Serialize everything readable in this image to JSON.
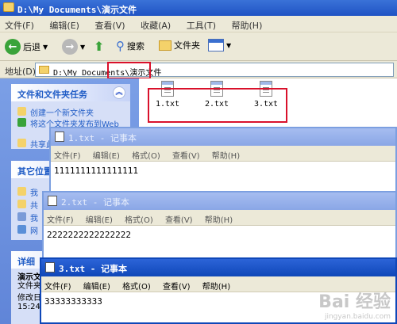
{
  "explorer": {
    "title": "D:\\My Documents\\演示文件",
    "menu": [
      "文件(F)",
      "编辑(E)",
      "查看(V)",
      "收藏(A)",
      "工具(T)",
      "帮助(H)"
    ],
    "toolbar": {
      "back": "后退",
      "search": "搜索",
      "folders": "文件夹"
    },
    "address_label": "地址(D)",
    "address_value": "D:\\My Documents\\演示文件",
    "tasks_header": "文件和文件夹任务",
    "task_items": [
      "创建一个新文件夹",
      "将这个文件夹发布到Web",
      "共享此文件夹"
    ],
    "other_places_header": "其它位置",
    "other_places": [
      "我",
      "共",
      "我",
      "网"
    ],
    "details_header": "详细",
    "details_lines": [
      "演示文",
      "文件夹",
      "修改日",
      "15:24"
    ],
    "files": [
      "1.txt",
      "2.txt",
      "3.txt"
    ]
  },
  "notepads": [
    {
      "title": "1.txt - 记事本",
      "menu": [
        "文件(F)",
        "编辑(E)",
        "格式(O)",
        "查看(V)",
        "帮助(H)"
      ],
      "content": "1111111111111111"
    },
    {
      "title": "2.txt - 记事本",
      "menu": [
        "文件(F)",
        "编辑(E)",
        "格式(O)",
        "查看(V)",
        "帮助(H)"
      ],
      "content": "2222222222222222"
    },
    {
      "title": "3.txt - 记事本",
      "menu": [
        "文件(F)",
        "编辑(E)",
        "格式(O)",
        "查看(V)",
        "帮助(H)"
      ],
      "content": "33333333333"
    }
  ],
  "watermark": {
    "brand": "Bai 经验",
    "url": "jingyan.baidu.com"
  }
}
